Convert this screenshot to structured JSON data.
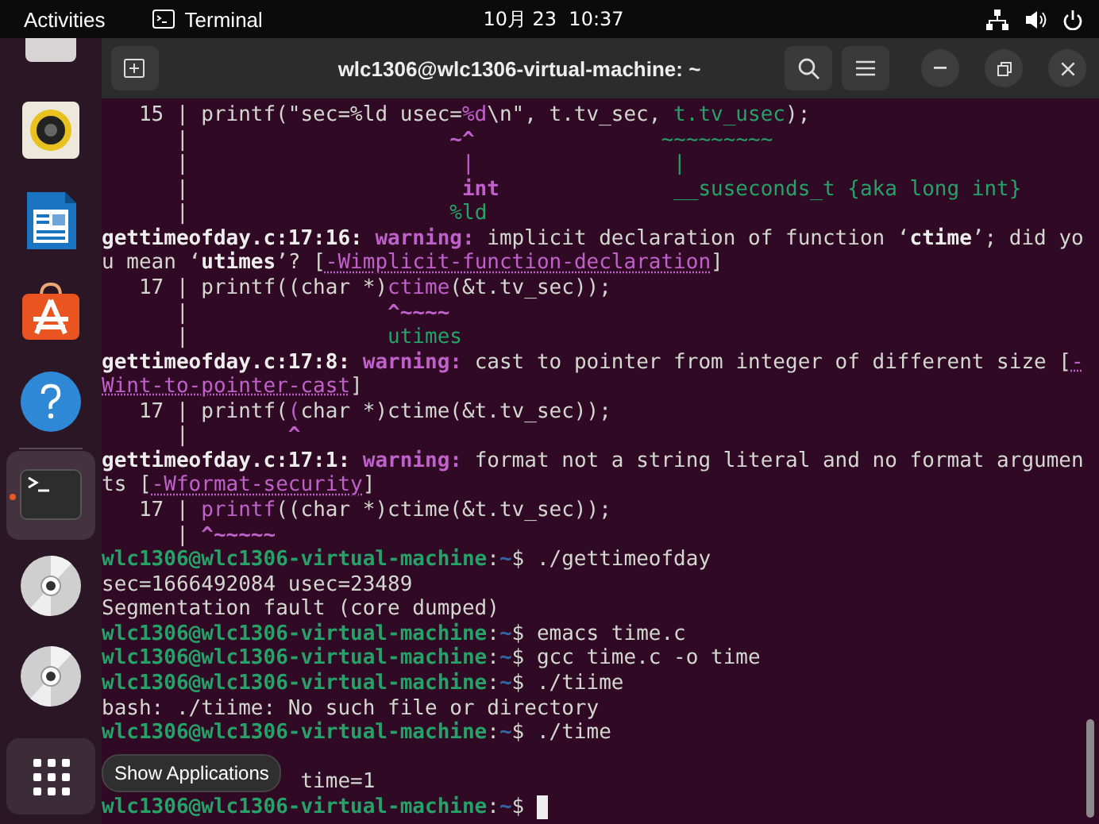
{
  "top_bar": {
    "activities": "Activities",
    "app_name": "Terminal",
    "clock": "10月 23  10:37"
  },
  "dock": {
    "items": [
      {
        "kind": "drive",
        "selected": false,
        "running": false
      },
      {
        "kind": "speaker",
        "selected": false,
        "running": false
      },
      {
        "kind": "document",
        "selected": false,
        "running": false
      },
      {
        "kind": "store",
        "selected": false,
        "running": false
      },
      {
        "kind": "help",
        "selected": false,
        "running": false
      },
      {
        "kind": "separator"
      },
      {
        "kind": "terminal",
        "selected": true,
        "running": true
      },
      {
        "kind": "disc",
        "selected": false,
        "running": false
      },
      {
        "kind": "disc",
        "selected": false,
        "running": false
      }
    ],
    "tooltip": "Show Applications"
  },
  "window": {
    "title": "wlc1306@wlc1306-virtual-machine: ~"
  },
  "terminal": {
    "lines": [
      {
        "segments": [
          {
            "kind": "plain",
            "text": "   15 | printf(\"sec=%ld usec="
          },
          {
            "kind": "purple",
            "text": "%d"
          },
          {
            "kind": "plain",
            "text": "\\n\", t.tv_sec, "
          },
          {
            "kind": "green",
            "text": "t.tv_usec"
          },
          {
            "kind": "plain",
            "text": ");"
          }
        ]
      },
      {
        "segments": [
          {
            "kind": "plain",
            "text": "      |                     "
          },
          {
            "kind": "warn",
            "text": "~^"
          },
          {
            "kind": "green",
            "text": "               ~~~~~~~~~"
          }
        ]
      },
      {
        "segments": [
          {
            "kind": "plain",
            "text": "      |                      "
          },
          {
            "kind": "purple",
            "text": "|"
          },
          {
            "kind": "green",
            "text": "                |"
          }
        ]
      },
      {
        "segments": [
          {
            "kind": "plain",
            "text": "      |                      "
          },
          {
            "kind": "warn",
            "text": "int"
          },
          {
            "kind": "green",
            "text": "              __suseconds_t {aka long int}"
          }
        ]
      },
      {
        "segments": [
          {
            "kind": "plain",
            "text": "      |                     "
          },
          {
            "kind": "green",
            "text": "%ld"
          }
        ]
      },
      {
        "segments": [
          {
            "kind": "bold",
            "text": "gettimeofday.c:17:16:"
          },
          {
            "kind": "warn",
            "text": " warning:"
          },
          {
            "kind": "plain",
            "text": " implicit declaration of function ‘"
          },
          {
            "kind": "bold",
            "text": "ctime"
          },
          {
            "kind": "plain",
            "text": "’; did yo"
          }
        ]
      },
      {
        "segments": [
          {
            "kind": "plain",
            "text": "u mean ‘"
          },
          {
            "kind": "bold",
            "text": "utimes"
          },
          {
            "kind": "plain",
            "text": "’? ["
          },
          {
            "kind": "link",
            "text": "-Wimplicit-function-declaration"
          },
          {
            "kind": "plain",
            "text": "]"
          }
        ]
      },
      {
        "segments": [
          {
            "kind": "plain",
            "text": "   17 | printf((char *)"
          },
          {
            "kind": "purple",
            "text": "ctime"
          },
          {
            "kind": "plain",
            "text": "(&t.tv_sec));"
          }
        ]
      },
      {
        "segments": [
          {
            "kind": "plain",
            "text": "      |                "
          },
          {
            "kind": "warn",
            "text": "^~~~~"
          }
        ]
      },
      {
        "segments": [
          {
            "kind": "plain",
            "text": "      |                "
          },
          {
            "kind": "green",
            "text": "utimes"
          }
        ]
      },
      {
        "segments": [
          {
            "kind": "bold",
            "text": "gettimeofday.c:17:8:"
          },
          {
            "kind": "warn",
            "text": " warning:"
          },
          {
            "kind": "plain",
            "text": " cast to pointer from integer of different size ["
          },
          {
            "kind": "link",
            "text": "-"
          }
        ]
      },
      {
        "segments": [
          {
            "kind": "link",
            "text": "Wint-to-pointer-cast"
          },
          {
            "kind": "plain",
            "text": "]"
          }
        ]
      },
      {
        "segments": [
          {
            "kind": "plain",
            "text": "   17 | printf("
          },
          {
            "kind": "purple",
            "text": "("
          },
          {
            "kind": "plain",
            "text": "char *)ctime(&t.tv_sec));"
          }
        ]
      },
      {
        "segments": [
          {
            "kind": "plain",
            "text": "      |        "
          },
          {
            "kind": "warn",
            "text": "^"
          }
        ]
      },
      {
        "segments": [
          {
            "kind": "bold",
            "text": "gettimeofday.c:17:1:"
          },
          {
            "kind": "warn",
            "text": " warning:"
          },
          {
            "kind": "plain",
            "text": " format not a string literal and no format argumen"
          }
        ]
      },
      {
        "segments": [
          {
            "kind": "plain",
            "text": "ts ["
          },
          {
            "kind": "link",
            "text": "-Wformat-security"
          },
          {
            "kind": "plain",
            "text": "]"
          }
        ]
      },
      {
        "segments": [
          {
            "kind": "plain",
            "text": "   17 | "
          },
          {
            "kind": "purple",
            "text": "printf"
          },
          {
            "kind": "plain",
            "text": "((char *)ctime(&t.tv_sec));"
          }
        ]
      },
      {
        "segments": [
          {
            "kind": "plain",
            "text": "      | "
          },
          {
            "kind": "warn",
            "text": "^~~~~~"
          }
        ]
      },
      {
        "segments": [
          {
            "kind": "prompt",
            "text": "wlc1306@wlc1306-virtual-machine"
          },
          {
            "kind": "plain",
            "text": ":"
          },
          {
            "kind": "path",
            "text": "~"
          },
          {
            "kind": "plain",
            "text": "$ ./gettimeofday"
          }
        ]
      },
      {
        "segments": [
          {
            "kind": "plain",
            "text": "sec=1666492084 usec=23489"
          }
        ]
      },
      {
        "segments": [
          {
            "kind": "plain",
            "text": "Segmentation fault (core dumped)"
          }
        ]
      },
      {
        "segments": [
          {
            "kind": "prompt",
            "text": "wlc1306@wlc1306-virtual-machine"
          },
          {
            "kind": "plain",
            "text": ":"
          },
          {
            "kind": "path",
            "text": "~"
          },
          {
            "kind": "plain",
            "text": "$ emacs time.c"
          }
        ]
      },
      {
        "segments": [
          {
            "kind": "prompt",
            "text": "wlc1306@wlc1306-virtual-machine"
          },
          {
            "kind": "plain",
            "text": ":"
          },
          {
            "kind": "path",
            "text": "~"
          },
          {
            "kind": "plain",
            "text": "$ gcc time.c -o time"
          }
        ]
      },
      {
        "segments": [
          {
            "kind": "prompt",
            "text": "wlc1306@wlc1306-virtual-machine"
          },
          {
            "kind": "plain",
            "text": ":"
          },
          {
            "kind": "path",
            "text": "~"
          },
          {
            "kind": "plain",
            "text": "$ ./tiime"
          }
        ]
      },
      {
        "segments": [
          {
            "kind": "plain",
            "text": "bash: ./tiime: No such file or directory"
          }
        ]
      },
      {
        "segments": [
          {
            "kind": "prompt",
            "text": "wlc1306@wlc1306-virtual-machine"
          },
          {
            "kind": "plain",
            "text": ":"
          },
          {
            "kind": "path",
            "text": "~"
          },
          {
            "kind": "plain",
            "text": "$ ./time"
          }
        ]
      },
      {
        "kind": "covered"
      },
      {
        "segments": [
          {
            "kind": "plain",
            "text": "                time=1"
          }
        ]
      },
      {
        "segments": [
          {
            "kind": "prompt",
            "text": "wlc1306@wlc1306-virtual-machine"
          },
          {
            "kind": "plain",
            "text": ":"
          },
          {
            "kind": "path",
            "text": "~"
          },
          {
            "kind": "plain",
            "text": "$ "
          },
          {
            "kind": "cursor"
          }
        ]
      }
    ]
  }
}
